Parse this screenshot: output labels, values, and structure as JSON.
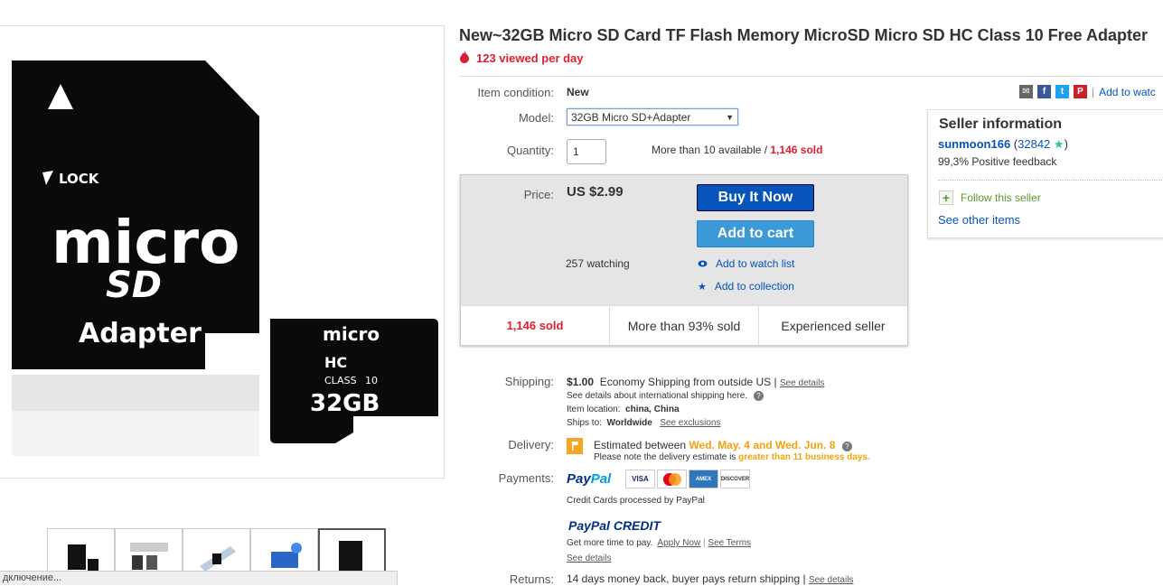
{
  "listing": {
    "title": "New~32GB Micro SD Card TF Flash Memory MicroSD Micro SD HC Class 10 Free Adapter",
    "views": "123 viewed per day"
  },
  "product_image": {
    "adapter_lock": "LOCK",
    "adapter_micro": "micro",
    "adapter_sd": "SD",
    "adapter_word": "Adapter",
    "card_micro": "micro",
    "card_hc": "HC",
    "card_class": "CLASS",
    "card_class_num": "10",
    "card_capacity": "32GB"
  },
  "details": {
    "condition_label": "Item condition:",
    "condition_value": "New",
    "model_label": "Model:",
    "model_value": "32GB Micro SD+Adapter",
    "quantity_label": "Quantity:",
    "quantity_value": "1",
    "available_text": "More than 10 available / ",
    "sold_text": "1,146 sold"
  },
  "price": {
    "label": "Price:",
    "value": "US $2.99",
    "buy_now": "Buy It Now",
    "add_to_cart": "Add to cart",
    "watching": "257 watching",
    "watch_list": "Add to watch list",
    "collection": "Add to collection",
    "stats": [
      "1,146 sold",
      "More than 93% sold",
      "Experienced seller"
    ]
  },
  "shipping": {
    "label": "Shipping:",
    "cost": "$1.00",
    "method": "Economy Shipping from outside US |",
    "see_details": "See details",
    "intl_note": "See details about international shipping here.",
    "location_label": "Item location:",
    "location_value": "china, China",
    "ships_label": "Ships to:",
    "ships_value": "Worldwide",
    "see_exclusions": "See exclusions"
  },
  "delivery": {
    "label": "Delivery:",
    "prefix": "Estimated between ",
    "dates": "Wed. May. 4 and Wed. Jun. 8",
    "note_prefix": "Please note the delivery estimate is ",
    "note_highlight": "greater than 11 business days."
  },
  "payments": {
    "label": "Payments:",
    "paypal_pay": "Pay",
    "paypal_pal": "Pal",
    "cards": [
      "VISA",
      "MC",
      "AMEX",
      "DISCOVER"
    ],
    "cc_note": "Credit Cards processed by PayPal",
    "credit_pay": "PayPal",
    "credit_word": "CREDIT",
    "more_time": "Get more time to pay.",
    "apply_now": "Apply Now",
    "see_terms": "See Terms",
    "see_details": "See details"
  },
  "returns": {
    "label": "Returns:",
    "text": "14 days money back, buyer pays return shipping |",
    "see_details": "See details"
  },
  "share": {
    "watch_link": "Add to watc"
  },
  "seller": {
    "title": "Seller information",
    "name": "sunmoon166",
    "feedback_open": " (",
    "feedback_count": "32842",
    "feedback_close": ")",
    "positive": "99,3% Positive feedback",
    "follow": "Follow this seller",
    "other_items": "See other items"
  },
  "browser": {
    "status": "дключение..."
  },
  "colors": {
    "ebay_blue": "#0654ba",
    "ebay_red": "#dd1e31",
    "delivery_orange": "#f0a30a",
    "cart_blue": "#3d9ad9"
  }
}
